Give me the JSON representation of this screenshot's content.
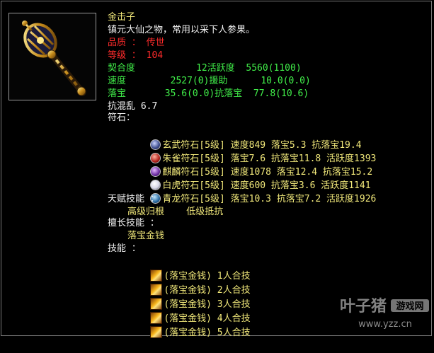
{
  "item": {
    "name": "金击子",
    "description": "镇元大仙之物，常用以采下人参果。",
    "quality": "品质 ： 传世",
    "level": "等级 ： 104"
  },
  "stats": [
    "契合度           12活跃度  5560(1100)",
    "速度        2527(0)援助      10.0(0.0)",
    "落宝       35.6(0.0)抗落宝  77.8(10.6)",
    "抗混乱 6.7"
  ],
  "runes_label": "符石：",
  "runes": [
    {
      "text": "玄武符石[5级] 速度849 落宝5.3 抗落宝19.4",
      "icon": "xuanwu-rune-icon",
      "color": "#3a4a8a"
    },
    {
      "text": "朱雀符石[5级] 落宝7.6 抗落宝11.8 活跃度1393",
      "icon": "zhuque-rune-icon",
      "color": "#b0201a"
    },
    {
      "text": "麒麟符石[5级] 速度1078 落宝12.4 抗落宝15.2",
      "icon": "qilin-rune-icon",
      "color": "#6a2aa0"
    },
    {
      "text": "白虎符石[5级] 速度600 抗落宝3.6 活跃度1141",
      "icon": "baihu-rune-icon",
      "color": "#d8d8e8"
    },
    {
      "text": "青龙符石[5级] 落宝10.3 抗落宝7.2 活跃度1926",
      "icon": "qinglong-rune-icon",
      "color": "#2a6aa0"
    }
  ],
  "talent_label": "天赋技能 ：",
  "talent_skills": "高级归根    低级抵抗",
  "specialty_label": "擅长技能 ：",
  "specialty_skill": "落宝金钱",
  "skills_label": "技能 ：",
  "skills": [
    "(落宝金钱) 1人合技",
    "(落宝金钱) 2人合技",
    "(落宝金钱) 3人合技",
    "(落宝金钱) 4人合技",
    "(落宝金钱) 5人合技"
  ],
  "watermark": {
    "brand": "叶子猪",
    "tag": "游戏网",
    "url": "www.yzz.cn"
  }
}
